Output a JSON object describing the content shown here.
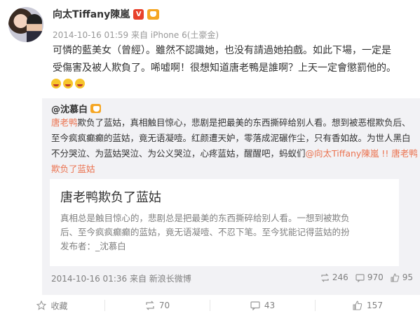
{
  "post": {
    "author": "向太Tiffany陳嵐",
    "verified_badge": "V",
    "meta": "2014-10-16 01:59 来自 iPhone 6(土豪金)",
    "line1": "可憐的藍美女（曾經）。雖然不認識她，也没有請過她拍戲。如此下場，一定是",
    "line2": "受傷害及被人欺負了。唏嘘啊！很想知道唐老鴨是誰啊？上天一定會懲罰他的。",
    "emoji_icons": [
      "crying-face-icon",
      "sad-face-icon",
      "crying-face-icon"
    ]
  },
  "retweet": {
    "author": "@沈慕白",
    "line1_mention": "唐老鸭",
    "line1_rest": "欺负了蓝姑，真相触目惊心，悲剧是把最美的东西撕碎给别人看。想到被恶棍欺负后、",
    "line2": "至今疯疯癫癫的蓝姑，竟无语凝噎。红颜遭天妒，零落成泥碾作尘，只有香如故。为世人黑白",
    "line3_text": "不分哭泣、为蓝姑哭泣、为公义哭泣，心疼蓝姑，醒醒吧，蚂蚁们",
    "line3_mention": "@向太Tiffany陳嵐 !! 唐老鸭",
    "line4_mention": "欺负了蓝姑",
    "card": {
      "title": "唐老鸭欺负了蓝姑",
      "line1": "真相总是触目惊心的，悲剧总是把最美的东西撕碎给别人看。一想到被欺负",
      "line2": "后、至今疯疯癫癫的蓝姑，竟无语凝噎、不忍下笔。至今犹能记得蓝姑的扮",
      "line3": "发布者：_沈慕白"
    },
    "time": "2014-10-16 01:36 来自 新浪长微博",
    "reposts": "246",
    "comments": "970",
    "likes": "95"
  },
  "actions": {
    "favorite": "收藏",
    "repost": "70",
    "comment": "43",
    "like": "157"
  }
}
